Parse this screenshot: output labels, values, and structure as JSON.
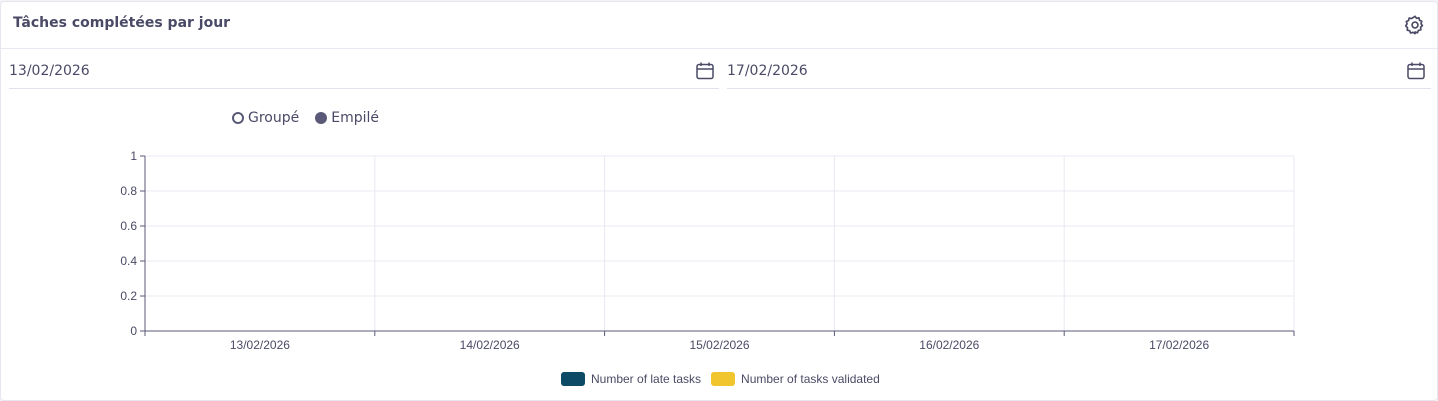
{
  "card": {
    "title": "Tâches complétées par jour"
  },
  "filters": {
    "start_date": "13/02/2026",
    "end_date": "17/02/2026"
  },
  "mode": {
    "options": [
      "Groupé",
      "Empilé"
    ],
    "selected": "Empilé"
  },
  "colors": {
    "late": "#0d4a66",
    "validated": "#f0c52e"
  },
  "chart_data": {
    "type": "bar",
    "categories": [
      "13/02/2026",
      "14/02/2026",
      "15/02/2026",
      "16/02/2026",
      "17/02/2026"
    ],
    "series": [
      {
        "name": "Number of late tasks",
        "values": [
          0,
          0,
          0,
          0,
          0
        ],
        "color": "#0d4a66"
      },
      {
        "name": "Number of tasks validated",
        "values": [
          0,
          0,
          0,
          0,
          0
        ],
        "color": "#f0c52e"
      }
    ],
    "yticks": [
      "0",
      "0.2",
      "0.4",
      "0.6",
      "0.8",
      "1"
    ],
    "ylim": [
      0,
      1
    ],
    "grid": true,
    "stacked": true,
    "legend": "bottom"
  }
}
